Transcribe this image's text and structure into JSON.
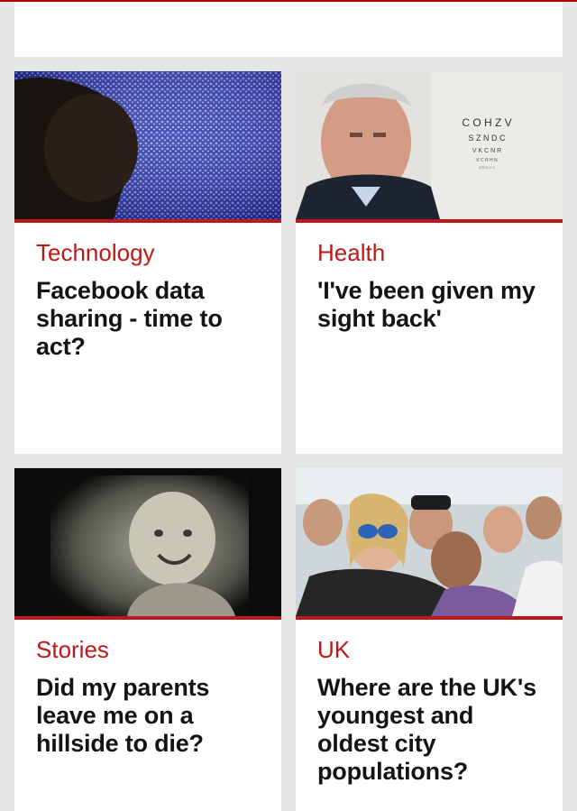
{
  "colors": {
    "accent": "#bb1919",
    "background": "#e6e6e6",
    "card": "#ffffff"
  },
  "stories": [
    {
      "section": "Technology",
      "headline": "Facebook data sharing - time to act?",
      "image": "silhouette-crowd-image"
    },
    {
      "section": "Health",
      "headline": "'I've been given my sight back'",
      "image": "elderly-man-eye-chart-image",
      "eye_chart": [
        "C O H Z V",
        "S Z N D C",
        "V K C N R",
        "K C R H N",
        "Z R D V C"
      ]
    },
    {
      "section": "Stories",
      "headline": "Did my parents leave me on a hillside to die?",
      "image": "vintage-baby-photo-image"
    },
    {
      "section": "UK",
      "headline": "Where are the UK's youngest and oldest city populations?",
      "image": "festival-crowd-image"
    }
  ]
}
